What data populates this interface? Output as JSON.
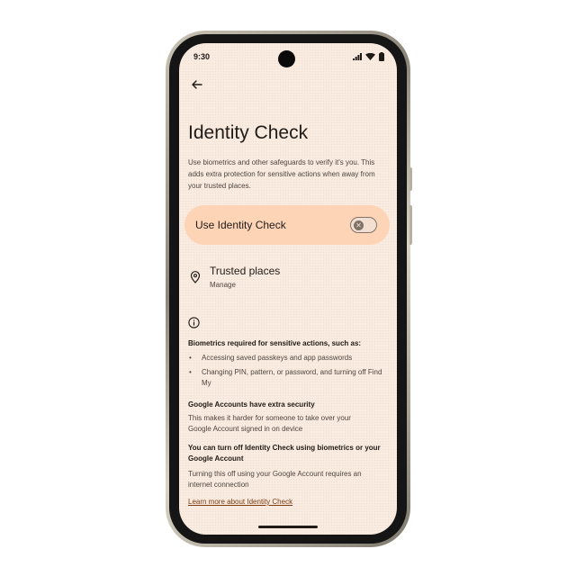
{
  "status_bar": {
    "time": "9:30",
    "icons": [
      "signal-icon",
      "wifi-icon",
      "battery-icon"
    ]
  },
  "header": {
    "back_icon": "back-arrow-icon",
    "title": "Identity Check",
    "description": "Use biometrics and other safeguards to verify it's you. This adds extra protection for sensitive actions when away from your trusted places."
  },
  "main_toggle": {
    "label": "Use Identity Check",
    "state": "off"
  },
  "trusted_places": {
    "icon": "location-pin-icon",
    "title": "Trusted places",
    "subtitle": "Manage"
  },
  "info": {
    "icon": "info-icon",
    "biometrics_heading": "Biometrics required for sensitive actions, such as:",
    "bullets": [
      "Accessing saved passkeys and app passwords",
      "Changing PIN, pattern, or password, and turning off Find My"
    ],
    "sections": [
      {
        "heading": "Google Accounts have extra security",
        "body": "This makes it harder for someone to take over your Google Account signed in on device"
      },
      {
        "heading": "You can turn off Identity Check using biometrics or your Google Account",
        "body": "Turning this off using your Google Account requires an internet connection"
      }
    ],
    "learn_more": "Learn more about Identity Check"
  },
  "colors": {
    "screen_background": "#f9ebe0",
    "toggle_card": "#fed4b7",
    "link": "#7a3e14",
    "phone_frame": "#151515"
  }
}
